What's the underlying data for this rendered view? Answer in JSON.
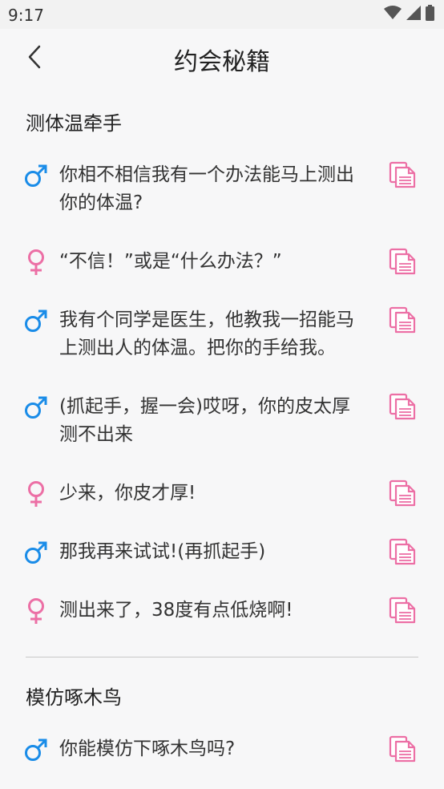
{
  "status": {
    "time": "9:17"
  },
  "appbar": {
    "title": "约会秘籍"
  },
  "sections": [
    {
      "title": "测体温牵手",
      "lines": [
        {
          "gender": "male",
          "text": "你相不相信我有一个办法能马上测出你的体温?"
        },
        {
          "gender": "female",
          "text": "“不信！”或是“什么办法？”"
        },
        {
          "gender": "male",
          "text": "我有个同学是医生，他教我一招能马上测出人的体温。把你的手给我。"
        },
        {
          "gender": "male",
          "text": "(抓起手，握一会)哎呀，你的皮太厚测不出来"
        },
        {
          "gender": "female",
          "text": "少来，你皮才厚!"
        },
        {
          "gender": "male",
          "text": "那我再来试试!(再抓起手)"
        },
        {
          "gender": "female",
          "text": "测出来了，38度有点低烧啊!"
        }
      ]
    },
    {
      "title": "模仿啄木鸟",
      "lines": [
        {
          "gender": "male",
          "text": "你能模仿下啄木鸟吗?"
        }
      ]
    }
  ],
  "colors": {
    "male": "#1a8ce8",
    "female": "#ec6fa5",
    "copy": "#ec6fa5"
  }
}
